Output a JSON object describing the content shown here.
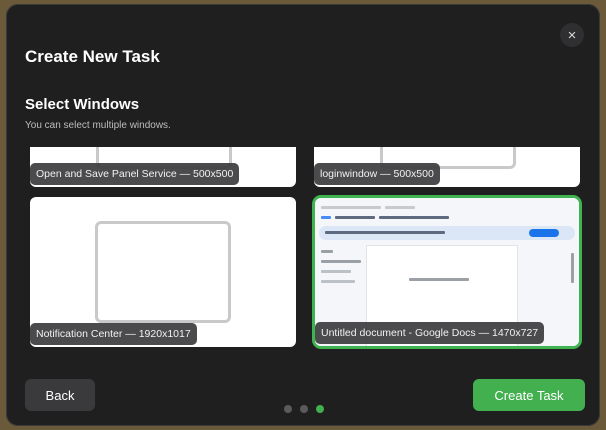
{
  "dialog": {
    "title": "Create New Task",
    "close_icon": "×",
    "section_title": "Select Windows",
    "section_subtitle": "You can select multiple windows."
  },
  "windows": [
    {
      "label": "Open and Save Panel Service — 500x500",
      "selected": false
    },
    {
      "label": "loginwindow — 500x500",
      "selected": false
    },
    {
      "label": "Notification Center — 1920x1017",
      "selected": false
    },
    {
      "label": "Untitled document - Google Docs — 1470x727",
      "selected": true
    }
  ],
  "footer": {
    "back_label": "Back",
    "create_label": "Create Task",
    "pages": 3,
    "active_page": 3
  },
  "colors": {
    "accent": "#42b04f",
    "dialog_bg": "#1f1f20"
  }
}
